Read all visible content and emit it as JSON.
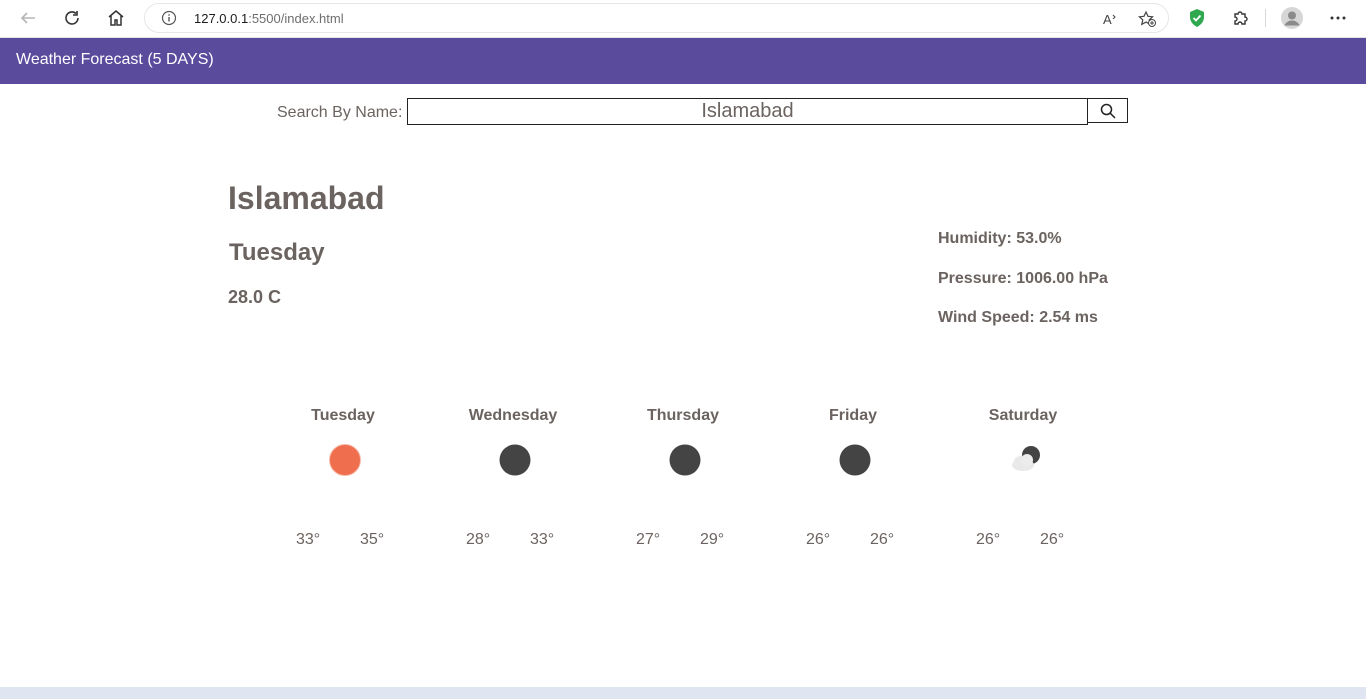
{
  "browser": {
    "url_host": "127.0.0.1",
    "url_rest": ":5500/index.html"
  },
  "header": {
    "title": "Weather Forecast (5 DAYS)"
  },
  "search": {
    "label": "Search By Name:",
    "value": "Islamabad"
  },
  "current": {
    "city": "Islamabad",
    "day": "Tuesday",
    "temp": "28.0 C",
    "humidity": "Humidity: 53.0%",
    "pressure": "Pressure: 1006.00 hPa",
    "wind": "Wind Speed: 2.54 ms"
  },
  "forecast": [
    {
      "day": "Tuesday",
      "icon": "sun-icon",
      "low": "33°",
      "high": "35°"
    },
    {
      "day": "Wednesday",
      "icon": "moon-icon",
      "low": "28°",
      "high": "33°"
    },
    {
      "day": "Thursday",
      "icon": "moon-icon",
      "low": "27°",
      "high": "29°"
    },
    {
      "day": "Friday",
      "icon": "moon-icon",
      "low": "26°",
      "high": "26°"
    },
    {
      "day": "Saturday",
      "icon": "cloud-moon-icon",
      "low": "26°",
      "high": "26°"
    }
  ],
  "colors": {
    "header": "#5a4b9d",
    "sun": "#ee6e4d",
    "moon": "#444444",
    "text": "#6b6360"
  }
}
